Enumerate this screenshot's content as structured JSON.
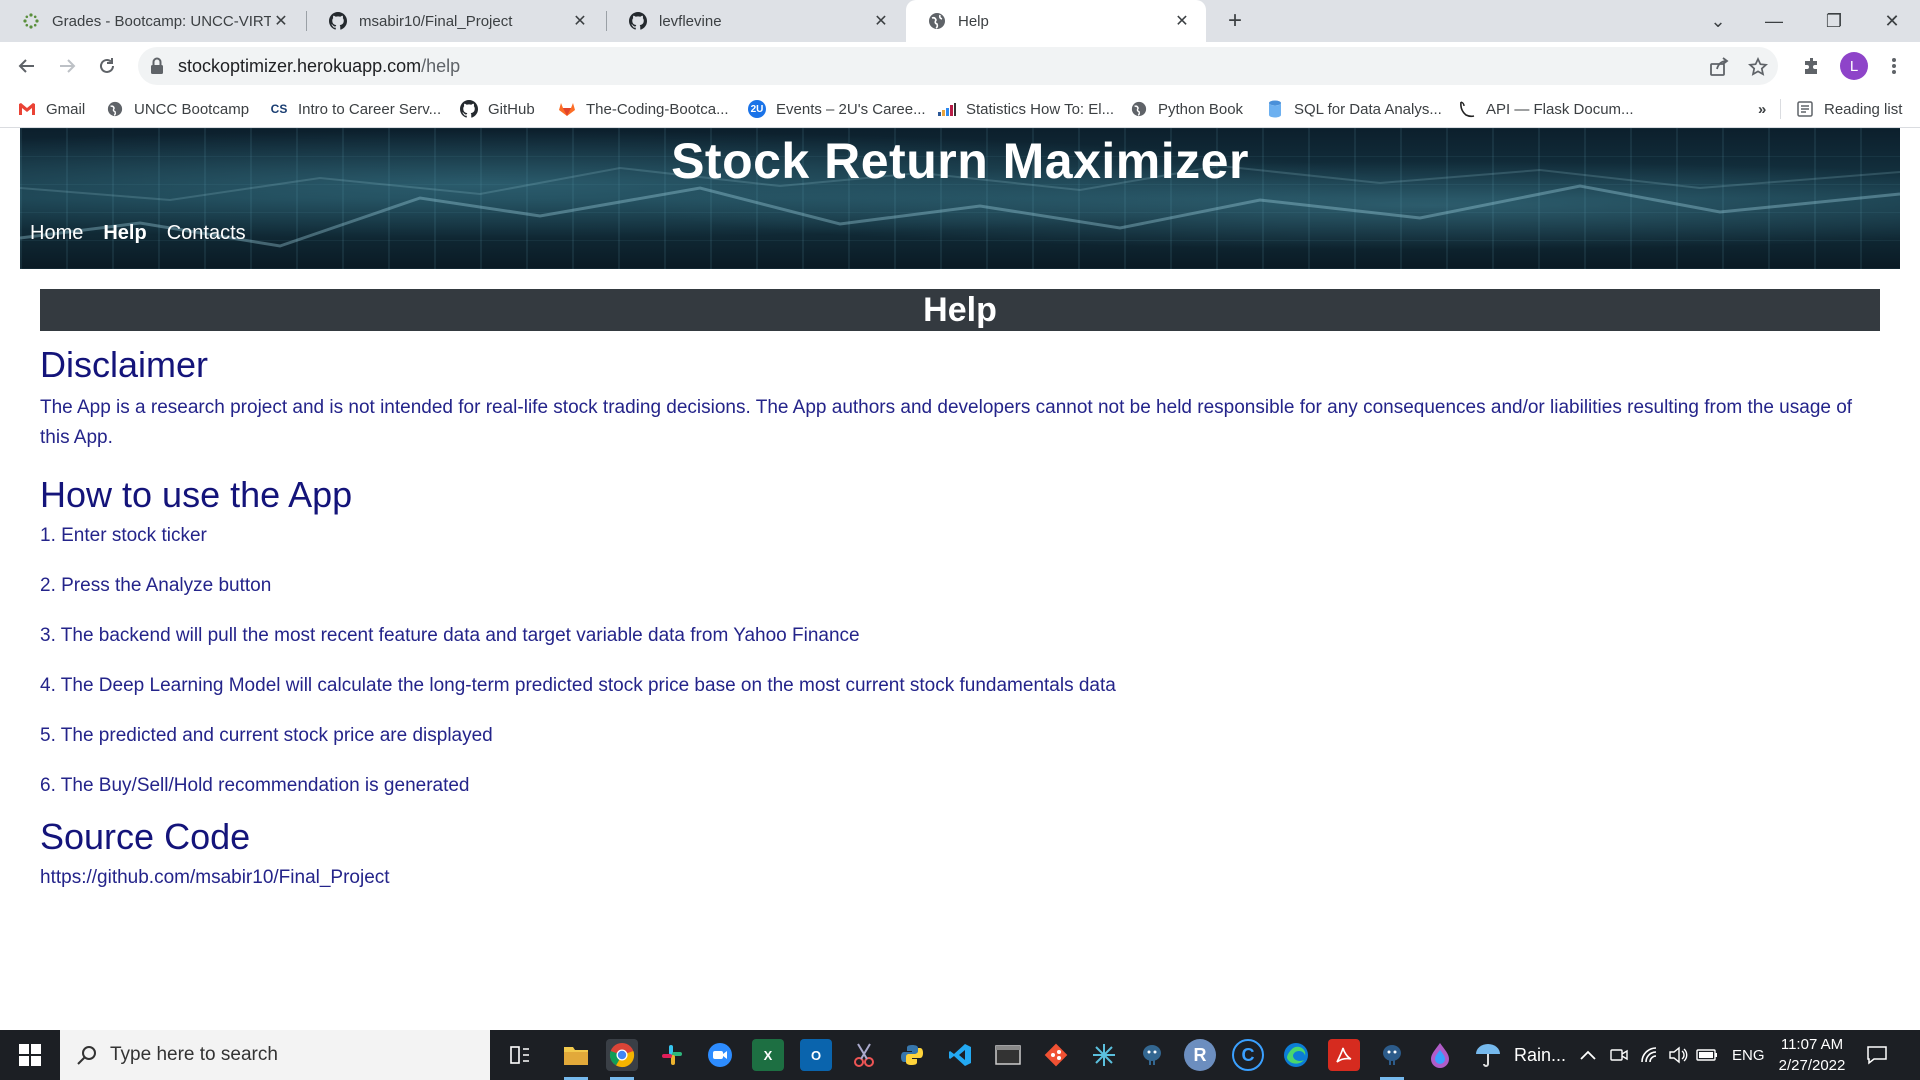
{
  "browser": {
    "tabs": [
      {
        "title": "Grades - Bootcamp: UNCC-VIRT-",
        "icon": "canvas-icon",
        "active": false
      },
      {
        "title": "msabir10/Final_Project",
        "icon": "github-icon",
        "active": false
      },
      {
        "title": "levflevine",
        "icon": "github-icon",
        "active": false
      },
      {
        "title": "Help",
        "icon": "globe-icon",
        "active": true
      }
    ],
    "address": {
      "domain": "stockoptimizer.herokuapp.com",
      "path": "/help"
    },
    "profile_initial": "L",
    "bookmarks": [
      {
        "label": "Gmail",
        "icon": "gmail-icon"
      },
      {
        "label": "UNCC Bootcamp",
        "icon": "globe-icon"
      },
      {
        "label": "Intro to Career Serv...",
        "icon": "cs-icon",
        "icon_text": "CS"
      },
      {
        "label": "GitHub",
        "icon": "github-icon"
      },
      {
        "label": "The-Coding-Bootca...",
        "icon": "gitlab-icon"
      },
      {
        "label": "Events – 2U's Caree...",
        "icon": "2u-icon",
        "icon_text": "2U"
      },
      {
        "label": "Statistics How To: El...",
        "icon": "bar-chart-icon"
      },
      {
        "label": "Python Book",
        "icon": "globe-icon"
      },
      {
        "label": "SQL for Data Analys...",
        "icon": "database-icon"
      },
      {
        "label": "API — Flask Docum...",
        "icon": "flask-icon"
      }
    ],
    "bookmarks_overflow": "»",
    "reading_list": "Reading list"
  },
  "page": {
    "site_title": "Stock Return Maximizer",
    "nav": [
      {
        "label": "Home",
        "current": false
      },
      {
        "label": "Help",
        "current": true
      },
      {
        "label": "Contacts",
        "current": false
      }
    ],
    "banner": "Help",
    "disclaimer": {
      "heading": "Disclaimer",
      "text": "The App is a research project and is not intended for real-life stock trading decisions. The App authors and developers cannot not be held responsible for any consequences and/or liabilities resulting from the usage of this App."
    },
    "howto": {
      "heading": "How to use the App",
      "steps": [
        "1. Enter stock ticker",
        "2. Press the Analyze button",
        "3. The backend will pull the most recent feature data and target variable data from Yahoo Finance",
        "4. The Deep Learning Model will calculate the long-term predicted stock price base on the most current stock fundamentals data",
        "5. The predicted and current stock price are displayed",
        "6. The Buy/Sell/Hold recommendation is generated"
      ]
    },
    "source": {
      "heading": "Source Code",
      "link": "https://github.com/msabir10/Final_Project"
    }
  },
  "taskbar": {
    "search_placeholder": "Type here to search",
    "weather": "Rain...",
    "language": "ENG",
    "time": "11:07 AM",
    "date": "2/27/2022",
    "apps": [
      {
        "name": "task-view-icon",
        "label": ""
      },
      {
        "name": "file-explorer-icon",
        "label": ""
      },
      {
        "name": "chrome-icon",
        "label": ""
      },
      {
        "name": "slack-icon",
        "label": ""
      },
      {
        "name": "zoom-icon",
        "label": ""
      },
      {
        "name": "excel-icon",
        "label": "X"
      },
      {
        "name": "outlook-icon",
        "label": "O"
      },
      {
        "name": "snipping-icon",
        "label": ""
      },
      {
        "name": "python-icon",
        "label": ""
      },
      {
        "name": "vscode-icon",
        "label": ""
      },
      {
        "name": "terminal-icon",
        "label": ""
      },
      {
        "name": "git-icon",
        "label": ""
      },
      {
        "name": "snowflake-icon",
        "label": ""
      },
      {
        "name": "postgres-icon",
        "label": ""
      },
      {
        "name": "r-icon",
        "label": "R"
      },
      {
        "name": "cortana-icon",
        "label": "C"
      },
      {
        "name": "edge-icon",
        "label": ""
      },
      {
        "name": "acrobat-icon",
        "label": ""
      },
      {
        "name": "pgadmin-icon",
        "label": ""
      },
      {
        "name": "anaconda-icon",
        "label": ""
      }
    ],
    "colors": {
      "taskbar": "#1c1f24",
      "accent": "#76b9ed"
    }
  },
  "colors": {
    "heading": "#14147a",
    "body_text": "#24248a",
    "banner_bg": "#343a40"
  }
}
